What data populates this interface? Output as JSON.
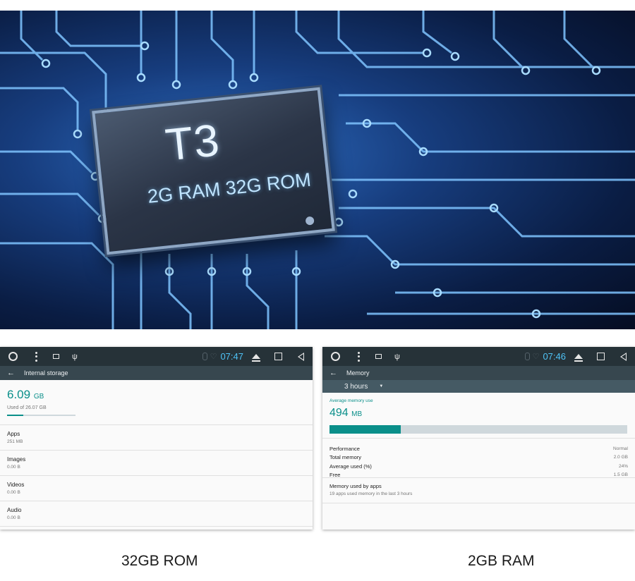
{
  "hero": {
    "chip_title": "T3",
    "chip_spec": "2G RAM 32G ROM"
  },
  "storage_panel": {
    "time": "07:47",
    "title": "Internal storage",
    "used_value": "6.09",
    "used_unit": "GB",
    "used_of": "Used of 26.07 GB",
    "used_fraction": 0.234,
    "items": [
      {
        "name": "Apps",
        "value": "251 MB"
      },
      {
        "name": "Images",
        "value": "0.00 B"
      },
      {
        "name": "Videos",
        "value": "0.00 B"
      },
      {
        "name": "Audio",
        "value": "0.00 B"
      }
    ]
  },
  "memory_panel": {
    "time": "07:46",
    "title": "Memory",
    "period": "3 hours",
    "avg_label": "Average memory use",
    "avg_value": "494",
    "avg_unit": "MB",
    "avg_used_fraction": 0.24,
    "stats": [
      {
        "key": "Performance",
        "value": "Normal"
      },
      {
        "key": "Total memory",
        "value": "2.0 GB"
      },
      {
        "key": "Average used (%)",
        "value": "24%"
      },
      {
        "key": "Free",
        "value": "1.5 GB"
      }
    ],
    "apps_title": "Memory used by apps",
    "apps_sub": "19 apps used memory in the last 3 hours"
  },
  "captions": {
    "left": "32GB ROM",
    "right": "2GB RAM"
  },
  "colors": {
    "accent": "#0a8f8a",
    "statusbar": "#263238",
    "appbar": "#37474f",
    "time": "#4fc3f7"
  }
}
